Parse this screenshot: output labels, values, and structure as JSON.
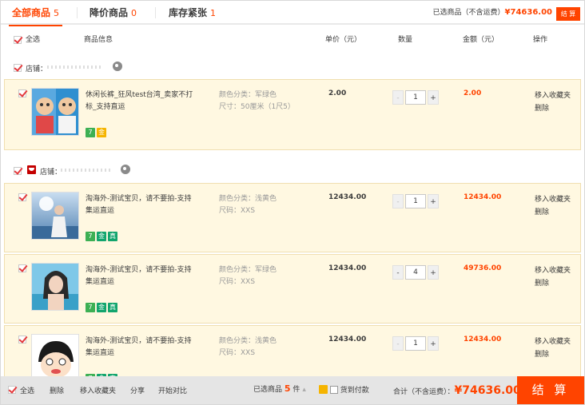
{
  "tabs": [
    {
      "label": "全部商品",
      "count": "5"
    },
    {
      "label": "降价商品",
      "count": "0"
    },
    {
      "label": "库存紧张",
      "count": "1"
    }
  ],
  "top_summary": {
    "label": "已选商品（不含运费）",
    "amount": "¥74636.00",
    "checkout": "结 算"
  },
  "columns": {
    "select_all": "全选",
    "info": "商品信息",
    "unit_price": "单价（元）",
    "quantity": "数量",
    "amount": "金额（元）",
    "ops": "操作"
  },
  "shops": [
    {
      "label": "店铺："
    },
    {
      "label": "店铺："
    }
  ],
  "items": [
    {
      "title": "休闲长裤_狂风test台湾_卖家不打标_支持直运",
      "sku1": "颜色分类：军绿色",
      "sku2": "尺寸：50厘米（1尺5）",
      "price": "2.00",
      "qty": "1",
      "subtotal": "2.00",
      "op1": "移入收藏夹",
      "op2": "删除",
      "badges": [
        "7",
        "金"
      ]
    },
    {
      "title": "淘海外-测试宝贝，请不要拍-支持集运直运",
      "sku1": "颜色分类：浅黄色",
      "sku2": "尺码：XXS",
      "price": "12434.00",
      "qty": "1",
      "subtotal": "12434.00",
      "op1": "移入收藏夹",
      "op2": "删除",
      "badges": [
        "7",
        "金",
        "真"
      ]
    },
    {
      "title": "淘海外-测试宝贝，请不要拍-支持集运直运",
      "sku1": "颜色分类：军绿色",
      "sku2": "尺码：XXS",
      "price": "12434.00",
      "qty": "4",
      "subtotal": "49736.00",
      "op1": "移入收藏夹",
      "op2": "删除",
      "badges": [
        "7",
        "金",
        "真"
      ]
    },
    {
      "title": "淘海外-测试宝贝，请不要拍-支持集运直运",
      "sku1": "颜色分类：浅黄色",
      "sku2": "尺码：XXS",
      "price": "12434.00",
      "qty": "1",
      "subtotal": "12434.00",
      "op1": "移入收藏夹",
      "op2": "删除",
      "badges": [
        "7",
        "金",
        "真"
      ]
    }
  ],
  "bottom": {
    "select_all": "全选",
    "delete": "删除",
    "move_fav": "移入收藏夹",
    "share": "分享",
    "compare": "开始对比",
    "selected_label": "已选商品",
    "selected_count": "5",
    "selected_unit": "件",
    "pay_label": "货到付款",
    "total_label": "合计（不含运费）：",
    "total": "¥74636.00",
    "checkout": "结 算"
  }
}
